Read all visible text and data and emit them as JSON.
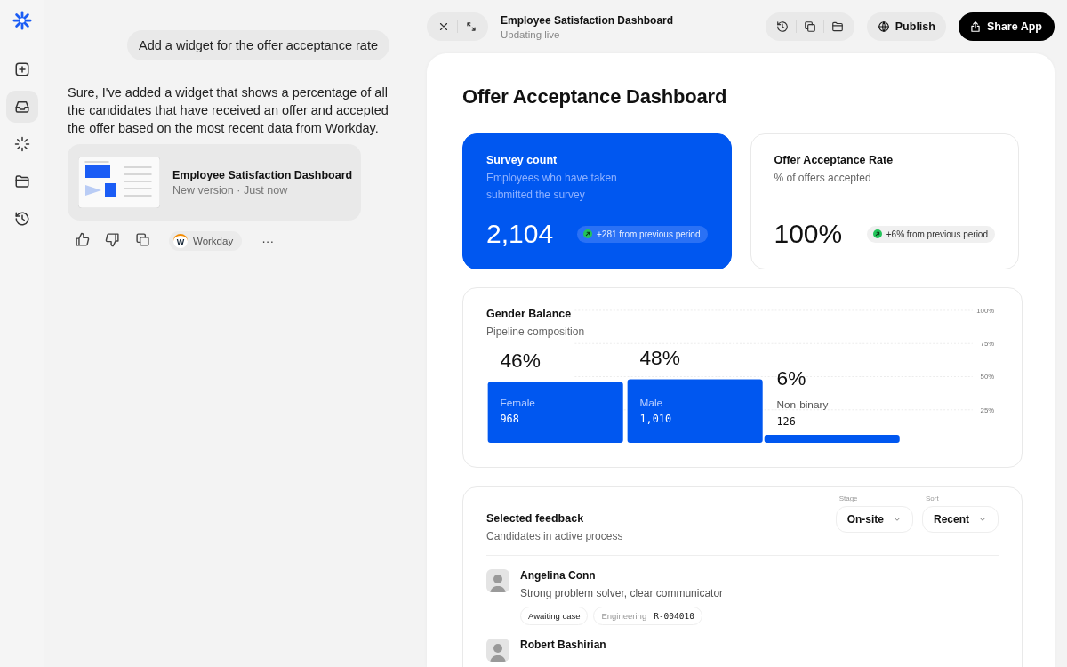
{
  "sidebar": {
    "items": [
      {
        "kind": "new",
        "selected": false
      },
      {
        "kind": "inbox",
        "selected": true
      },
      {
        "kind": "spark",
        "selected": false
      },
      {
        "kind": "folder",
        "selected": false
      },
      {
        "kind": "history",
        "selected": false
      }
    ]
  },
  "chat": {
    "user_message": "Add a widget for the offer acceptance rate",
    "reply": "Sure, I've added a widget that shows a percentage of all the candidates that have received an offer and accepted the offer based on the most recent data from Workday.",
    "artifact": {
      "title": "Employee Satisfaction Dashboard",
      "subtitle": "New version · Just now"
    },
    "actions": {
      "source": {
        "logo_letter": "W",
        "label": "Workday"
      },
      "more": "···"
    }
  },
  "header": {
    "title": "Employee Satisfaction Dashboard",
    "subtitle": "Updating live",
    "publish": "Publish",
    "share": "Share App"
  },
  "dashboard": {
    "title": "Offer Acceptance Dashboard",
    "stats": [
      {
        "title": "Survey count",
        "subtitle": "Employees who have taken submitted the survey",
        "value": "2,104",
        "change": "+281 from previous period",
        "highlighted": true
      },
      {
        "title": "Offer Acceptance Rate",
        "subtitle": "% of offers accepted",
        "value": "100%",
        "change": "+6% from previous period",
        "highlighted": false
      }
    ],
    "gender": {
      "subtitle": "Pipeline composition",
      "bar_counts": [
        "968",
        "1,010",
        "126"
      ],
      "chart_data": {
        "type": "bar",
        "title": "Gender Balance",
        "categories": [
          "Female",
          "Male",
          "Non-binary"
        ],
        "values": [
          46,
          48,
          6
        ],
        "ylim": [
          0,
          100
        ],
        "yticks": [
          {
            "value": 25,
            "label": "25%"
          },
          {
            "value": 50,
            "label": "50%"
          },
          {
            "value": 75,
            "label": "75%"
          },
          {
            "value": 100,
            "label": "100%"
          }
        ],
        "grid": true,
        "value_labels": [
          "46%",
          "48%",
          "6%"
        ]
      }
    },
    "feedback": {
      "title": "Selected feedback",
      "subtitle": "Candidates in active process",
      "filters": [
        {
          "label": "Stage",
          "value": "On-site"
        },
        {
          "label": "Sort",
          "value": "Recent"
        }
      ],
      "candidates": [
        {
          "name": "Angelina Conn",
          "note": "Strong problem solver, clear communicator",
          "status": "Awaiting case",
          "department": "Engineering",
          "requisition": "R-004010"
        },
        {
          "name": "Robert Bashirian"
        }
      ]
    }
  }
}
